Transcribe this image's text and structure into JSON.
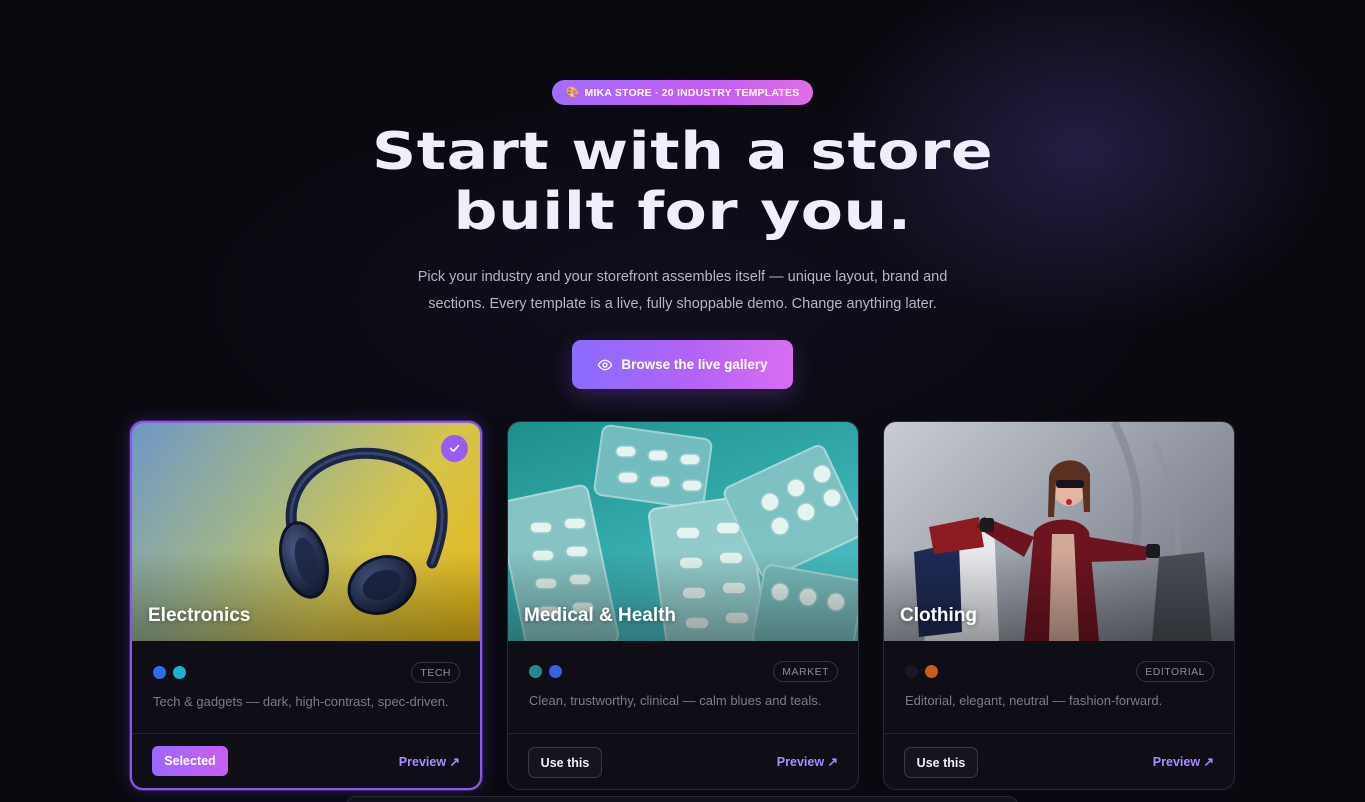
{
  "badge": {
    "icon": "palette-icon",
    "text": "MIKA STORE · 20 INDUSTRY TEMPLATES"
  },
  "headline": {
    "line1": "Start with a store",
    "line2": "built for you."
  },
  "subtitle": {
    "line1": "Pick your industry and your storefront assembles itself — unique layout, brand and",
    "line2": "sections. Every template is a live, fully shoppable demo. Change anything later."
  },
  "cta": {
    "icon": "eye-icon",
    "label": "Browse the live gallery"
  },
  "templates": [
    {
      "title": "Electronics",
      "tag": "TECH",
      "description": "Tech & gadgets — dark, high-contrast, spec-driven.",
      "colors": [
        "#2f6cf0",
        "#19b3d1"
      ],
      "selected": true,
      "action_label": "Selected",
      "preview_label": "Preview ↗"
    },
    {
      "title": "Medical & Health",
      "tag": "MARKET",
      "description": "Clean, trustworthy, clinical — calm blues and teals.",
      "colors": [
        "#1c8d8a",
        "#3c5fe6"
      ],
      "selected": false,
      "action_label": "Use this",
      "preview_label": "Preview ↗"
    },
    {
      "title": "Clothing",
      "tag": "EDITORIAL",
      "description": "Editorial, elegant, neutral — fashion-forward.",
      "colors": [
        "#16172a",
        "#c95d17"
      ],
      "selected": false,
      "action_label": "Use this",
      "preview_label": "Preview ↗"
    }
  ],
  "accent_colors": {
    "primary": "#a26bff",
    "secondary": "#d86ef0",
    "background": "#0a0910"
  }
}
